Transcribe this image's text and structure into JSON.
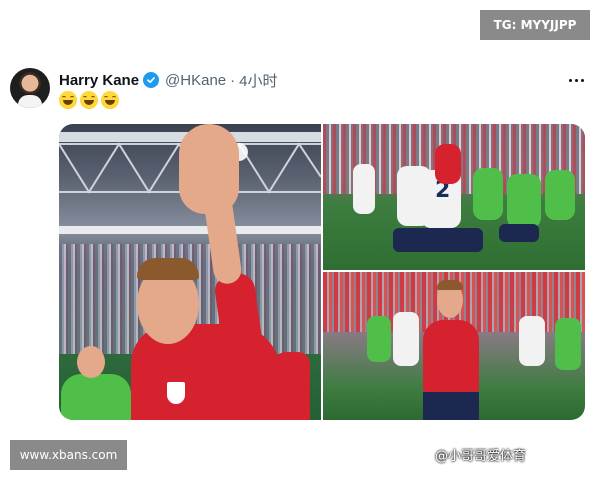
{
  "watermarks": {
    "top": "TG: MYYJJPP",
    "bottom": "www.xbans.com"
  },
  "post": {
    "author_name": "Harry Kane",
    "handle": "@HKane",
    "separator": "·",
    "time": "4小时",
    "verified": true,
    "emojis": [
      "grinning-squinting-face",
      "grinning-squinting-face",
      "grinning-squinting-face"
    ],
    "more_icon": "more-horizontal-icon",
    "image_source_caption": "@小哥哥爱体育"
  },
  "colors": {
    "verified_blue": "#1d9bf0",
    "handle_gray": "#536471",
    "watermark_bg": "#8a8a8a",
    "england_red": "#d6222f"
  }
}
